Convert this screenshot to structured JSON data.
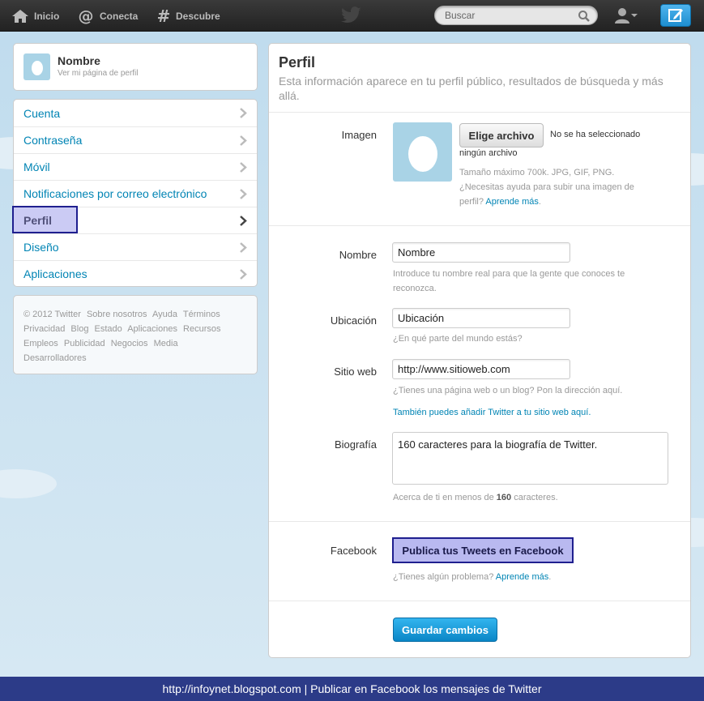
{
  "topbar": {
    "home_label": "Inicio",
    "connect_label": "Conecta",
    "discover_label": "Descubre",
    "search_placeholder": "Buscar",
    "icons": [
      "home-icon",
      "at-icon",
      "hashtag-icon",
      "twitter-bird-icon",
      "search-icon",
      "user-icon",
      "compose-icon"
    ]
  },
  "profile_card": {
    "name": "Nombre",
    "link": "Ver mi página de perfil"
  },
  "menu": {
    "items": [
      {
        "label": "Cuenta"
      },
      {
        "label": "Contraseña"
      },
      {
        "label": "Móvil"
      },
      {
        "label": "Notificaciones por correo electrónico"
      },
      {
        "label": "Perfil"
      },
      {
        "label": "Diseño"
      },
      {
        "label": "Aplicaciones"
      }
    ],
    "active_index": 4
  },
  "footer": {
    "links": [
      "© 2012 Twitter",
      "Sobre nosotros",
      "Ayuda",
      "Términos",
      "Privacidad",
      "Blog",
      "Estado",
      "Aplicaciones",
      "Recursos",
      "Empleos",
      "Publicidad",
      "Negocios",
      "Media",
      "Desarrolladores"
    ]
  },
  "main": {
    "title": "Perfil",
    "subtitle": "Esta información aparece en tu perfil público, resultados de búsqueda y más allá.",
    "image": {
      "label": "Imagen",
      "button": "Elige archivo",
      "status_1": "No se ha seleccionado",
      "status_2": "ningún archivo",
      "help_1": "Tamaño máximo 700k. JPG, GIF, PNG.",
      "help_2": "¿Necesitas ayuda para subir una imagen de",
      "help_3": "perfil?",
      "help_link": "Aprende más",
      "help_end": "."
    },
    "name": {
      "label": "Nombre",
      "value": "Nombre",
      "help_1": "Introduce tu nombre real para que la gente que conoces te",
      "help_2": "reconozca."
    },
    "location": {
      "label": "Ubicación",
      "value": "Ubicación",
      "help": "¿En qué parte del mundo estás?"
    },
    "website": {
      "label": "Sitio web",
      "value": "http://www.sitioweb.com",
      "help": "¿Tienes una página web o un blog? Pon la dirección aquí.",
      "link": "También puedes añadir Twitter a tu sitio web aquí."
    },
    "bio": {
      "label": "Biografía",
      "value": "160 caracteres para la biografía de Twitter.",
      "help_pre": "Acerca de ti en menos de ",
      "help_num": "160",
      "help_post": " caracteres."
    },
    "facebook": {
      "label": "Facebook",
      "button": "Publica tus Tweets en Facebook",
      "help": "¿Tienes algún problema?",
      "help_link": "Aprende más",
      "help_end": "."
    },
    "save_button": "Guardar cambios"
  },
  "banner": {
    "text": "http://infoynet.blogspot.com | Publicar en Facebook los mensajes de Twitter"
  },
  "colors": {
    "link": "#0084b4",
    "highlight": "#1f1f8f",
    "save": "#0a86c6",
    "banner": "#2c3b88"
  }
}
